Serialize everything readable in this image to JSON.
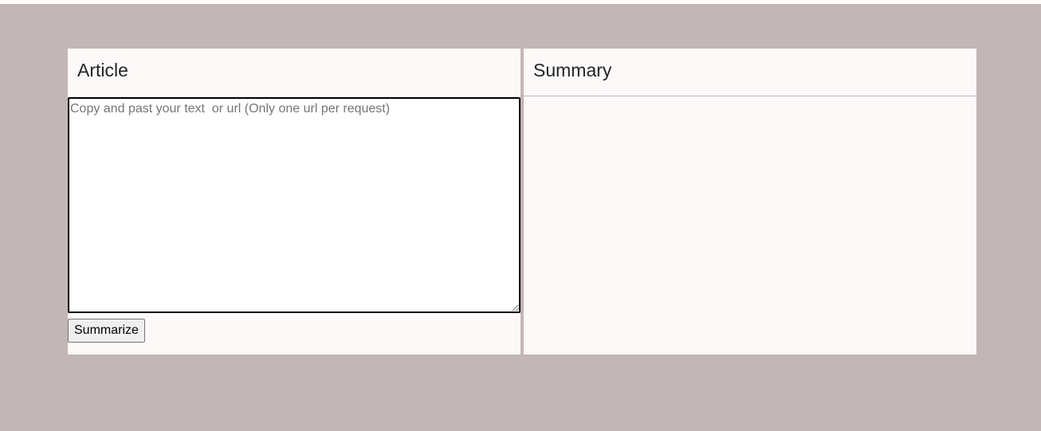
{
  "article": {
    "title": "Article",
    "input_value": "",
    "input_placeholder": "Copy and past your text  or url (Only one url per request)",
    "submit_label": "Summarize"
  },
  "summary": {
    "title": "Summary",
    "content": ""
  },
  "colors": {
    "page_background": "#c2b6b6",
    "panel_background": "#fdf9f8",
    "heading_text": "#212529"
  }
}
